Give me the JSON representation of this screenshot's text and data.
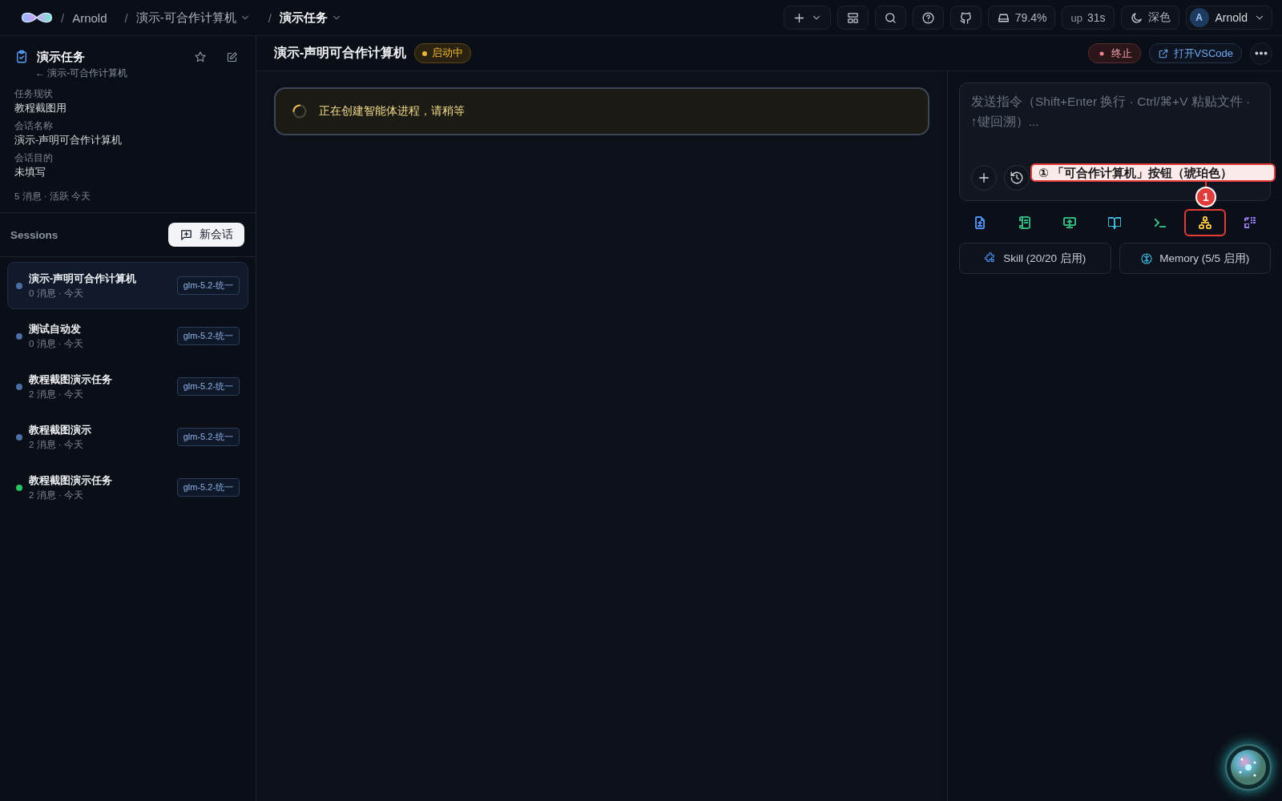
{
  "topbar": {
    "breadcrumbs": [
      {
        "separator": "/",
        "label": "Arnold",
        "dropdown": false,
        "current": false
      },
      {
        "separator": "/",
        "label": "演示-可合作计算机",
        "dropdown": true,
        "current": false
      },
      {
        "separator": "/",
        "label": "演示任务",
        "dropdown": true,
        "current": true
      }
    ],
    "actions": [
      {
        "kind": "add"
      },
      {
        "kind": "layout"
      },
      {
        "kind": "search"
      },
      {
        "kind": "help"
      },
      {
        "kind": "github"
      },
      {
        "kind": "disk",
        "text": "79.4%"
      },
      {
        "kind": "uptime",
        "label": "up",
        "text": "31s"
      },
      {
        "kind": "theme",
        "text": "深色"
      }
    ],
    "user": {
      "initial": "A",
      "name": "Arnold"
    }
  },
  "sidebar": {
    "task": {
      "title": "演示任务",
      "back": "← 演示-可合作计算机",
      "fields": [
        {
          "label": "任务现状",
          "value": "教程截图用"
        },
        {
          "label": "会话名称",
          "value": "演示-声明可合作计算机"
        },
        {
          "label": "会话目的",
          "value": "未填写"
        }
      ],
      "meta": "5 消息 · 活跃 今天"
    },
    "sessions": {
      "title": "Sessions",
      "new_button": "新会话",
      "items": [
        {
          "name": "演示-声明可合作计算机",
          "meta": "0 消息 · 今天",
          "model": "glm-5.2-统一",
          "selected": true,
          "color": "#4a6fa5"
        },
        {
          "name": "测试自动发",
          "meta": "0 消息 · 今天",
          "model": "glm-5.2-统一",
          "selected": false,
          "color": "#4a6fa5"
        },
        {
          "name": "教程截图演示任务",
          "meta": "2 消息 · 今天",
          "model": "glm-5.2-统一",
          "selected": false,
          "color": "#4a6fa5"
        },
        {
          "name": "教程截图演示",
          "meta": "2 消息 · 今天",
          "model": "glm-5.2-统一",
          "selected": false,
          "color": "#4a6fa5"
        },
        {
          "name": "教程截图演示任务",
          "meta": "2 消息 · 今天",
          "model": "glm-5.2-统一",
          "selected": false,
          "color": "#22c55e"
        }
      ]
    }
  },
  "header": {
    "title": "演示-声明可合作计算机",
    "status": "启动中",
    "stop_button": "终止",
    "vscode_button": "打开VSCode"
  },
  "notice": {
    "text": "正在创建智能体进程，请稍等"
  },
  "composer": {
    "placeholder": "发送指令（Shift+Enter 换行 · Ctrl/⌘+V 粘贴文件 · ↑键回溯）...",
    "tools": [
      {
        "kind": "file",
        "color": "#4b8ef0",
        "annotated": false
      },
      {
        "kind": "scroll",
        "color": "#2fb67c",
        "annotated": false
      },
      {
        "kind": "screen",
        "color": "#2fb67c",
        "annotated": false
      },
      {
        "kind": "book",
        "color": "#38b6d8",
        "annotated": false
      },
      {
        "kind": "terminal",
        "color": "#2fb67c",
        "annotated": false
      },
      {
        "kind": "network",
        "color": "#e8b93a",
        "annotated": true
      },
      {
        "kind": "grid",
        "color": "#9a7af0",
        "annotated": false
      }
    ],
    "panels": [
      {
        "kind": "skill",
        "label": "Skill (20/20 启用)"
      },
      {
        "kind": "memory",
        "label": "Memory (5/5 启用)"
      }
    ]
  },
  "annotation": {
    "number": "1",
    "text": "① 「可合作计算机」按钮（琥珀色）"
  }
}
